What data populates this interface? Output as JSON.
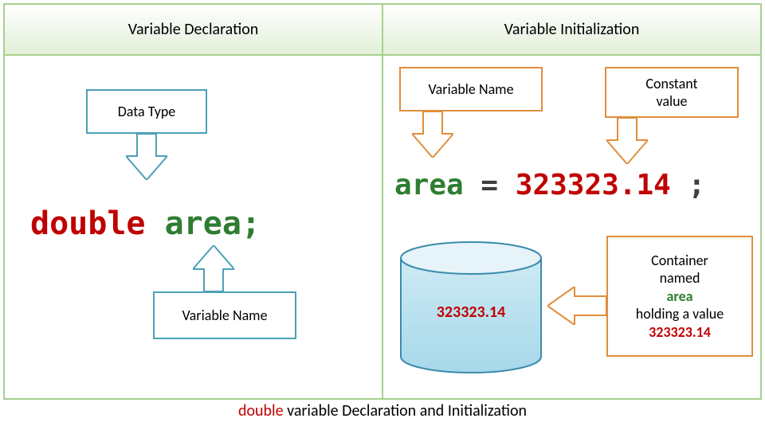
{
  "headers": {
    "left": "Variable Declaration",
    "right": "Variable Initialization"
  },
  "left": {
    "callout_datatype": "Data Type",
    "callout_varname": "Variable Name",
    "code_keyword": "double",
    "code_identifier": "area;"
  },
  "right": {
    "callout_varname": "Variable Name",
    "callout_constant_l1": "Constant",
    "callout_constant_l2": "value",
    "code_identifier": "area",
    "code_eq": "=",
    "code_number": "323323.14",
    "code_semi": ";",
    "cylinder_value": "323323.14",
    "container_l1": "Container",
    "container_l2": "named",
    "container_area": "area",
    "container_l4": "holding a value",
    "container_val": "323323.14"
  },
  "caption": {
    "keyword": "double",
    "rest": " variable Declaration and Initialization"
  }
}
